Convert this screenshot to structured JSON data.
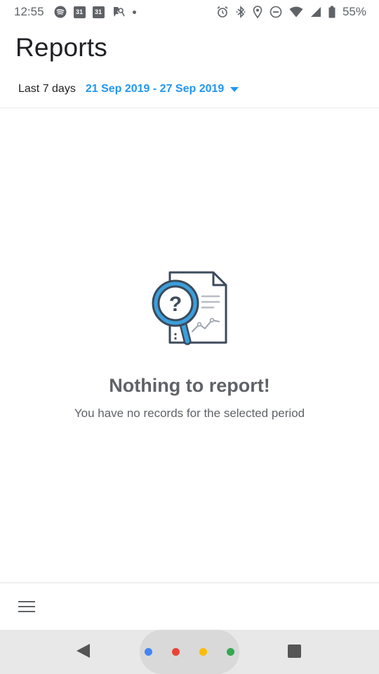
{
  "status_bar": {
    "time": "12:55",
    "calendar_day_1": "31",
    "calendar_day_2": "31",
    "battery_percent": "55%",
    "left_icons": [
      "spotify-icon",
      "calendar-icon",
      "calendar-icon",
      "hangouts-icon",
      "notification-dot-icon"
    ],
    "right_icons": [
      "alarm-icon",
      "bluetooth-icon",
      "location-icon",
      "do-not-disturb-icon",
      "wifi-icon",
      "signal-icon",
      "battery-icon"
    ]
  },
  "header": {
    "title": "Reports",
    "period_label": "Last 7 days",
    "period_range": "21 Sep 2019 - 27 Sep 2019"
  },
  "empty_state": {
    "illustration": "report-search-icon",
    "title": "Nothing to report!",
    "subtitle": "You have no records for the selected period"
  },
  "bottom_bar": {
    "menu_icon": "hamburger-menu-icon"
  },
  "nav_bar": {
    "back_icon": "back-triangle-icon",
    "home_icon": "assistant-home-icon",
    "recents_icon": "recents-square-icon",
    "assistant_colors": [
      "#4285f4",
      "#ea4335",
      "#fbbc04",
      "#34a853"
    ]
  },
  "colors": {
    "accent": "#2196f3",
    "text_primary": "#202124",
    "text_secondary": "#5f6368",
    "illustration_blue": "#3aa0dc",
    "illustration_dark": "#3c4a5c"
  }
}
